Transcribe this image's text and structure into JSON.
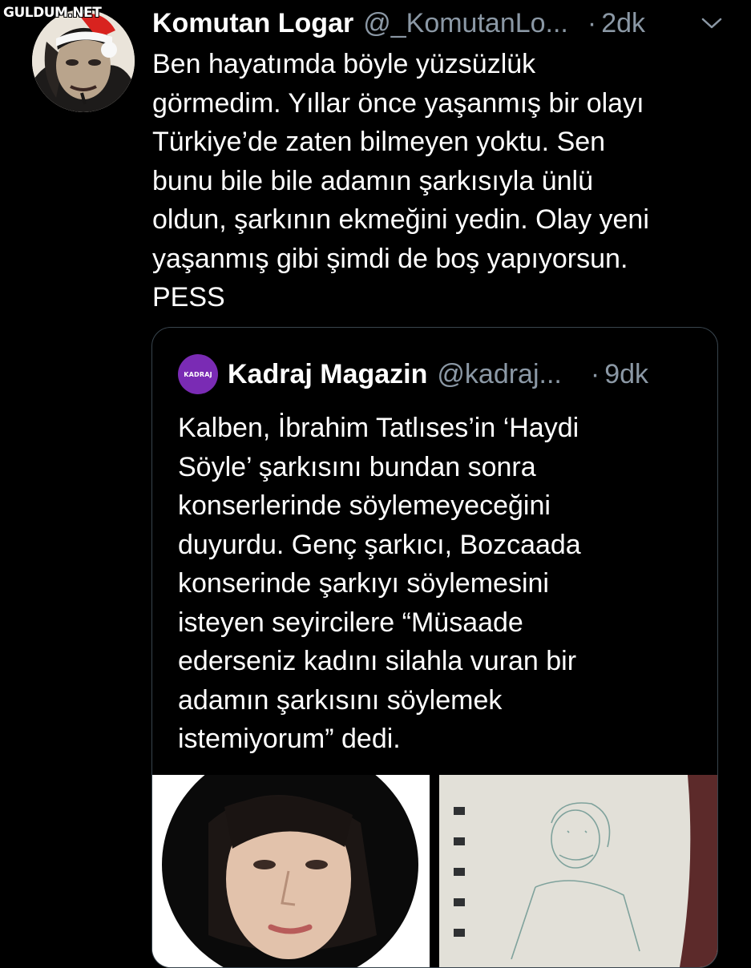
{
  "watermark": "GULDUM.NET",
  "tweet": {
    "author_name": "Komutan Logar",
    "author_handle": "@_KomutanLo...",
    "time": "2dk",
    "text": "Ben hayatımda böyle yüzsüzlük\ngörmedim. Yıllar önce yaşanmış bir olayı\nTürkiye’de zaten bilmeyen yoktu. Sen\nbunu bile bile adamın şarkısıyla ünlü\noldun, şarkının ekmeğini yedin. Olay yeni\nyaşanmış gibi şimdi de boş yapıyorsun.\nPESS",
    "more_icon": "chevron-down-icon"
  },
  "quoted_tweet": {
    "avatar_text": "KADRAJ",
    "author_name": "Kadraj Magazin",
    "author_handle": "@kadraj...",
    "time": "9dk",
    "text": "Kalben, İbrahim Tatlıses’in ‘Haydi\nSöyle’ şarkısını bundan sonra\nkonserlerinde söylemeyeceğini\nduyurdu. Genç şarkıcı, Bozcaada\nkonserinde şarkıyı söylemesini\nisteyen seyircilere “Müsaade\nederseniz kadını silahla vuran bir\nadamın şarkısını söylemek\nistemiyorum” dedi."
  },
  "colors": {
    "background": "#000000",
    "primary_text": "#ffffff",
    "secondary_text": "#8b98a5",
    "card_border": "#38444d",
    "kadraj_purple": "#7a2bb4"
  }
}
